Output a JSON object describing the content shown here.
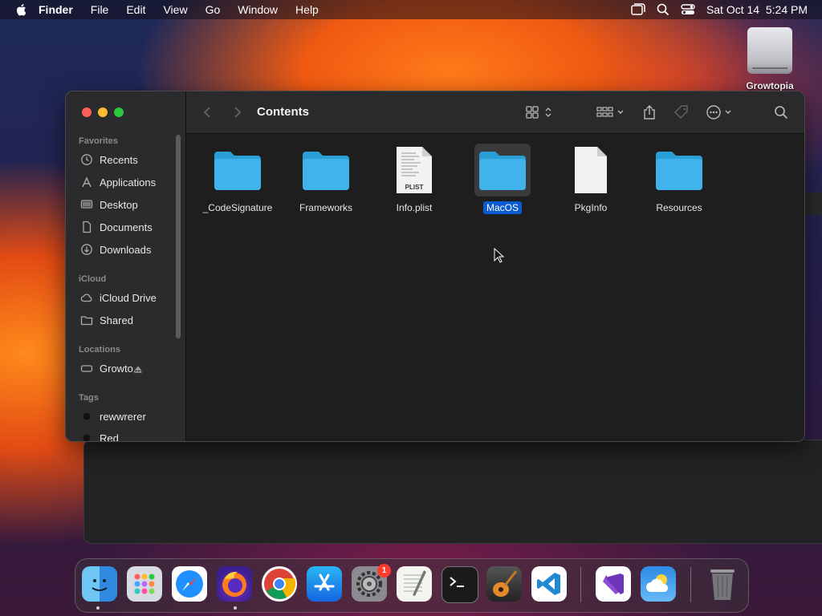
{
  "menubar": {
    "app_name": "Finder",
    "menus": [
      "File",
      "Edit",
      "View",
      "Go",
      "Window",
      "Help"
    ],
    "datetime": "Sat Oct 14  5:24 PM"
  },
  "desktop": {
    "drive_label": "Growtopia"
  },
  "finder": {
    "title": "Contents",
    "sidebar": {
      "favorites_header": "Favorites",
      "favorites": [
        {
          "label": "Recents",
          "icon": "clock-icon"
        },
        {
          "label": "Applications",
          "icon": "applications-icon"
        },
        {
          "label": "Desktop",
          "icon": "desktop-icon"
        },
        {
          "label": "Documents",
          "icon": "document-icon"
        },
        {
          "label": "Downloads",
          "icon": "download-icon"
        }
      ],
      "icloud_header": "iCloud",
      "icloud": [
        {
          "label": "iCloud Drive",
          "icon": "cloud-icon"
        },
        {
          "label": "Shared",
          "icon": "shared-folder-icon"
        }
      ],
      "locations_header": "Locations",
      "locations": [
        {
          "label": "Growto...",
          "icon": "disk-icon"
        }
      ],
      "tags_header": "Tags",
      "tags": [
        {
          "label": "rewwrerer",
          "color": "#111111"
        },
        {
          "label": "Red",
          "color": "#111111"
        }
      ]
    },
    "files": [
      {
        "name": "_CodeSignature",
        "type": "folder",
        "selected": false
      },
      {
        "name": "Frameworks",
        "type": "folder",
        "selected": false
      },
      {
        "name": "Info.plist",
        "type": "plist",
        "badge": "PLIST",
        "selected": false
      },
      {
        "name": "MacOS",
        "type": "folder",
        "selected": true
      },
      {
        "name": "PkgInfo",
        "type": "file",
        "selected": false
      },
      {
        "name": "Resources",
        "type": "folder",
        "selected": false
      }
    ]
  },
  "dock": {
    "apps": [
      "Finder",
      "Launchpad",
      "Safari",
      "Firefox",
      "Chrome",
      "App Store",
      "System Settings",
      "TextEdit",
      "Terminal",
      "GarageBand",
      "Visual Studio Code",
      "Visual Studio",
      "Weather",
      "Trash"
    ],
    "settings_badge": "1"
  },
  "colors": {
    "accent": "#0a5bd1",
    "folder": "#3fb3ea",
    "close": "#ff5f57",
    "minimize": "#febc2e",
    "maximize": "#28c840"
  }
}
